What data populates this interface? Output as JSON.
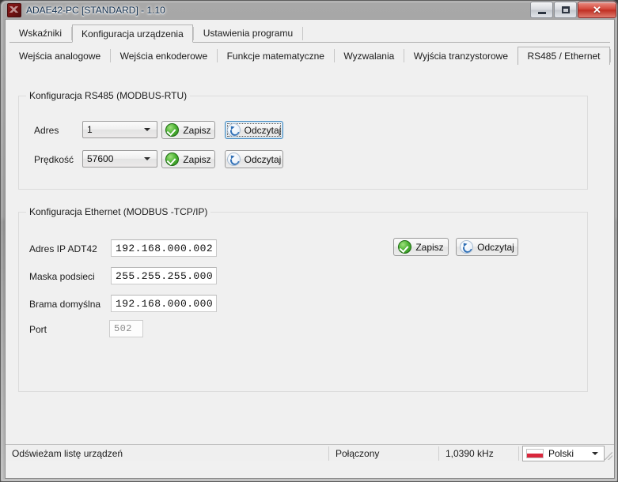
{
  "window": {
    "title": "ADAE42-PC [STANDARD] - 1.10",
    "icon": "app-icon",
    "buttons": {
      "minimize": "minimize-icon",
      "maximize": "maximize-icon",
      "close": "✕"
    }
  },
  "tabs_primary": [
    {
      "label": "Wskaźniki",
      "selected": false
    },
    {
      "label": "Konfiguracja urządzenia",
      "selected": true
    },
    {
      "label": "Ustawienia programu",
      "selected": false
    }
  ],
  "tabs_secondary": [
    {
      "label": "Wejścia analogowe",
      "selected": false
    },
    {
      "label": "Wejścia enkoderowe",
      "selected": false
    },
    {
      "label": "Funkcje matematyczne",
      "selected": false
    },
    {
      "label": "Wyzwalania",
      "selected": false
    },
    {
      "label": "Wyjścia tranzystorowe",
      "selected": false
    },
    {
      "label": "RS485 / Ethernet",
      "selected": true
    }
  ],
  "rs485": {
    "group_title": "Konfiguracja RS485 (MODBUS-RTU)",
    "address": {
      "label": "Adres",
      "value": "1",
      "save_label": "Zapisz",
      "read_label": "Odczytaj"
    },
    "speed": {
      "label": "Prędkość",
      "value": "57600",
      "save_label": "Zapisz",
      "read_label": "Odczytaj"
    }
  },
  "ethernet": {
    "group_title": "Konfiguracja Ethernet (MODBUS -TCP/IP)",
    "save_label": "Zapisz",
    "read_label": "Odczytaj",
    "fields": [
      {
        "label": "Adres IP ADT42",
        "value": "192.168.000.002",
        "disabled": false
      },
      {
        "label": "Maska podsieci",
        "value": "255.255.255.000",
        "disabled": false
      },
      {
        "label": "Brama domyślna",
        "value": "192.168.000.000",
        "disabled": false
      },
      {
        "label": "Port",
        "value": "502",
        "disabled": true
      }
    ]
  },
  "statusbar": {
    "message": "Odświeżam listę urządzeń",
    "connection": "Połączony",
    "frequency": "1,0390 kHz",
    "language": "Polski"
  },
  "colors": {
    "accent_save": "#3f9e28",
    "accent_read": "#2f6fb5",
    "close_button": "#d4483c",
    "flag_red": "#d9273c",
    "window_bg": "#f0f0f0"
  }
}
